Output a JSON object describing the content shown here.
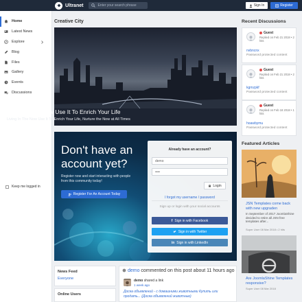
{
  "header": {
    "brand": "Ultranet",
    "search_placeholder": "Enter your search phrase",
    "signin_label": "Sign In",
    "register_label": "Register"
  },
  "sidebar": {
    "items": [
      {
        "label": "Home",
        "icon": "home-icon",
        "active": true
      },
      {
        "label": "Latest News",
        "icon": "news-icon"
      },
      {
        "label": "Explore",
        "icon": "compass-icon",
        "has_submenu": true
      },
      {
        "label": "Blog",
        "icon": "blog-icon"
      },
      {
        "label": "Files",
        "icon": "file-icon"
      },
      {
        "label": "Gallery",
        "icon": "image-icon"
      },
      {
        "label": "Events",
        "icon": "calendar-icon"
      },
      {
        "label": "Discussions",
        "icon": "comments-icon"
      }
    ]
  },
  "main": {
    "section_title": "Creative City",
    "hero": {
      "title": "Living In The Now Use It To Enrich Your Life",
      "subtitle": "Living In The Now Use It To Enrich Your Life, Nurture the Now at All Times"
    },
    "promo": {
      "title": "Don't have an account yet?",
      "text": "Register now and start interacting with people from this community today!",
      "button_label": "Register For An Account Today"
    },
    "login": {
      "heading": "Already have an account?",
      "username_value": "demo",
      "password_value": "••••",
      "remember_label": "Keep me logged in",
      "login_button": "Login",
      "forgot_link": "I forgot my username / password",
      "social_note": "Sign up or login with your social accounts",
      "facebook_label": "Sign in with Facebook",
      "twitter_label": "Sign in with Twitter",
      "linkedin_label": "Sign in with LinkedIn"
    },
    "news_feed": {
      "title": "News Feed",
      "link": "Everyone"
    },
    "online_users": {
      "title": "Online Users"
    },
    "activity": {
      "user": "demo",
      "action": "commented on this post about 11 hours ago",
      "post_user": "demo",
      "post_action": "shared a link",
      "post_time": "1 week ago",
      "post_text": "Доска объявлений - с домашними животными Купить или продать... (Доска объявлений животные)"
    }
  },
  "right": {
    "recent_title": "Recent Discussions",
    "discussions": [
      {
        "author": "Guest",
        "date": "Replied on Feb 21 2018 • 2 hits",
        "topic": "nvbncnx",
        "status": "Password protected content"
      },
      {
        "author": "Guest",
        "date": "Replied on Feb 21 2018 • 2 hits",
        "topic": "kgmzpkf",
        "status": "Password protected content"
      },
      {
        "author": "Guest",
        "date": "Replied on Feb 18 2018 • 1 hits",
        "topic": "hoawbymu",
        "status": "Password protected content"
      }
    ],
    "featured_title": "Featured Articles",
    "articles": [
      {
        "title": "JSN Templates come back with new upgraden",
        "text": "In September of 2017 JoomlaShine decided to retire all JSN free templates after...",
        "meta": "Super User 08 Mar 2018 • 2 hits"
      },
      {
        "title": "Are JoomlaShine Templates responsive?",
        "meta": "Super User 08 Mar 2018"
      }
    ]
  },
  "colors": {
    "topbar": "#1f2a3a",
    "accent": "#2d6bd3",
    "facebook": "#3b5998",
    "twitter": "#1da1f2",
    "linkedin": "#4a86b8"
  }
}
